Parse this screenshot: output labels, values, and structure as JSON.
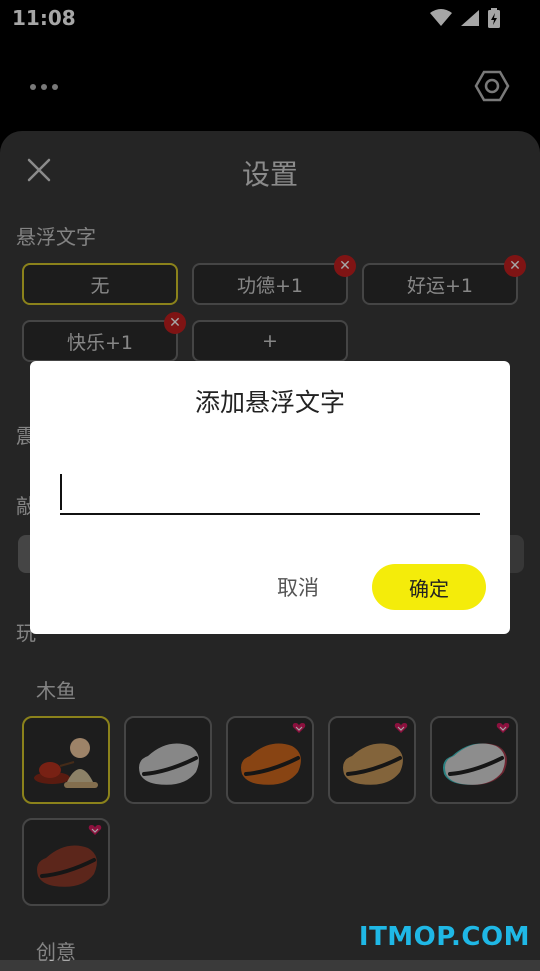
{
  "status": {
    "time": "11:08"
  },
  "sheet": {
    "title": "设置",
    "float_text_label": "悬浮文字",
    "float_chips": [
      {
        "label": "无",
        "selected": true,
        "deletable": false
      },
      {
        "label": "功德+1",
        "selected": false,
        "deletable": true
      },
      {
        "label": "好运+1",
        "selected": false,
        "deletable": true
      },
      {
        "label": "快乐+1",
        "selected": false,
        "deletable": true
      },
      {
        "label": "+",
        "selected": false,
        "deletable": false
      }
    ],
    "partial_labels": [
      "震",
      "敲",
      "玩"
    ],
    "muyu_label": "木鱼",
    "creative_label": "创意",
    "muyu_tiles": [
      {
        "name": "monk",
        "selected": true,
        "premium": false
      },
      {
        "name": "gray",
        "selected": false,
        "premium": false
      },
      {
        "name": "orange",
        "selected": false,
        "premium": true
      },
      {
        "name": "wood",
        "selected": false,
        "premium": true
      },
      {
        "name": "glitch",
        "selected": false,
        "premium": true
      },
      {
        "name": "red-brown",
        "selected": false,
        "premium": true
      }
    ]
  },
  "dialog": {
    "title": "添加悬浮文字",
    "input_value": "",
    "cancel_label": "取消",
    "ok_label": "确定"
  },
  "watermark": "ITMOP.COM",
  "colors": {
    "accent": "#f4ec0a",
    "selected_border": "#d6c82a",
    "delete_badge": "#c42020",
    "premium_heart": "#d81b60"
  }
}
